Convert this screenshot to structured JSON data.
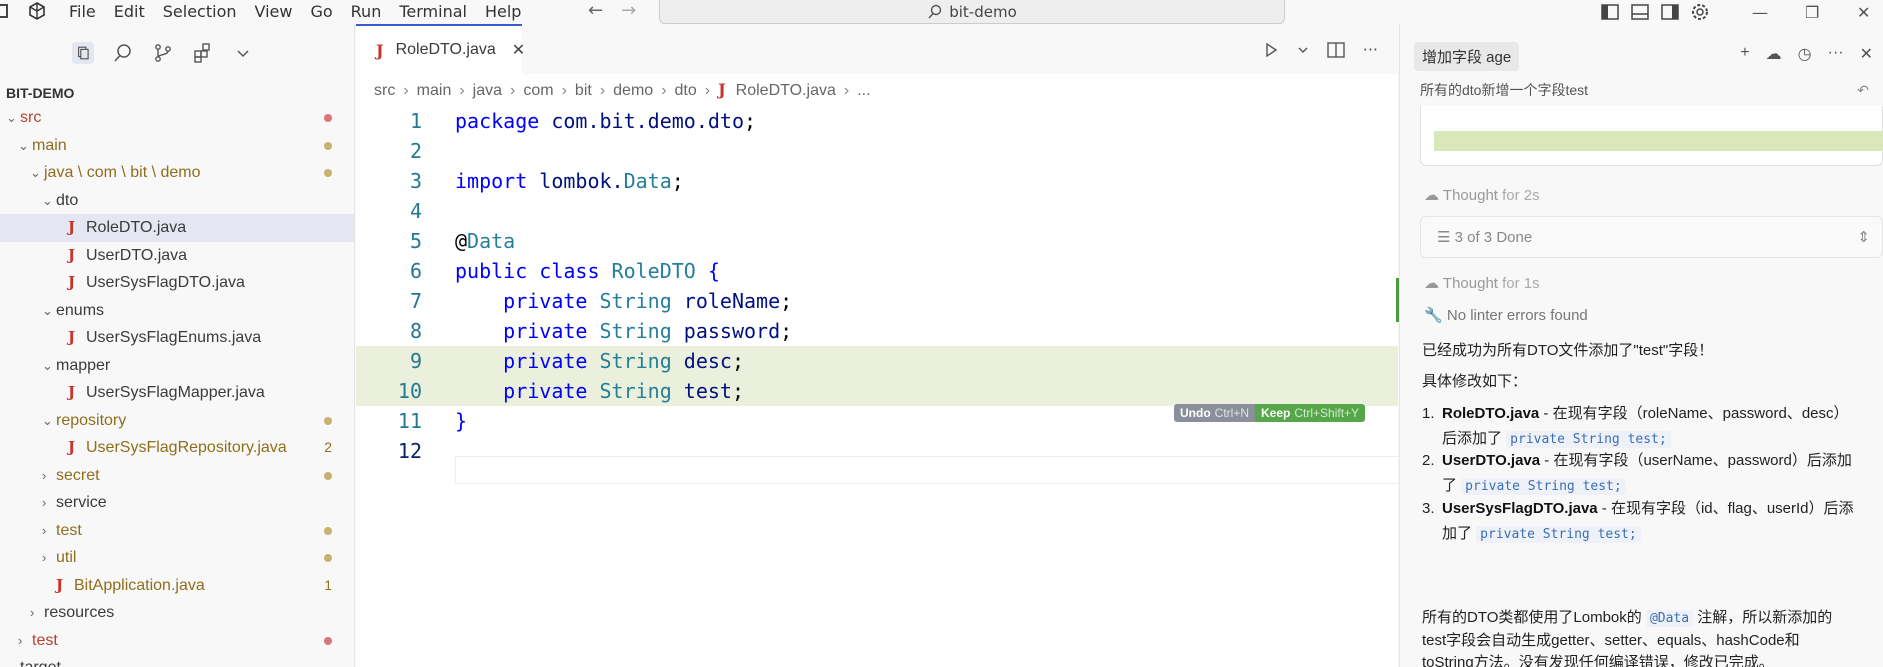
{
  "titlebar": {
    "menu": [
      "File",
      "Edit",
      "Selection",
      "View",
      "Go",
      "Run",
      "Terminal",
      "Help"
    ],
    "search_text": "bit-demo"
  },
  "explorer": {
    "root": "BIT-DEMO",
    "items": [
      {
        "label": "src",
        "indent": 0,
        "chev": "⌄",
        "kind": "folder",
        "state": "err",
        "marker": "dot-red"
      },
      {
        "label": "main",
        "indent": 1,
        "chev": "⌄",
        "kind": "folder",
        "state": "mod",
        "marker": "dot-tan"
      },
      {
        "label": "java \\ com \\ bit \\ demo",
        "indent": 2,
        "chev": "⌄",
        "kind": "folder",
        "state": "mod",
        "marker": "dot-tan"
      },
      {
        "label": "dto",
        "indent": 3,
        "chev": "⌄",
        "kind": "folder",
        "state": "",
        "marker": ""
      },
      {
        "label": "RoleDTO.java",
        "indent": 4,
        "chev": "",
        "kind": "java",
        "state": "sel",
        "marker": ""
      },
      {
        "label": "UserDTO.java",
        "indent": 4,
        "chev": "",
        "kind": "java",
        "state": "",
        "marker": ""
      },
      {
        "label": "UserSysFlagDTO.java",
        "indent": 4,
        "chev": "",
        "kind": "java",
        "state": "",
        "marker": ""
      },
      {
        "label": "enums",
        "indent": 3,
        "chev": "⌄",
        "kind": "folder",
        "state": "",
        "marker": ""
      },
      {
        "label": "UserSysFlagEnums.java",
        "indent": 4,
        "chev": "",
        "kind": "java",
        "state": "",
        "marker": ""
      },
      {
        "label": "mapper",
        "indent": 3,
        "chev": "⌄",
        "kind": "folder",
        "state": "",
        "marker": ""
      },
      {
        "label": "UserSysFlagMapper.java",
        "indent": 4,
        "chev": "",
        "kind": "java",
        "state": "",
        "marker": ""
      },
      {
        "label": "repository",
        "indent": 3,
        "chev": "⌄",
        "kind": "folder",
        "state": "mod",
        "marker": "dot-tan"
      },
      {
        "label": "UserSysFlagRepository.java",
        "indent": 4,
        "chev": "",
        "kind": "java",
        "state": "mod",
        "marker": "2"
      },
      {
        "label": "secret",
        "indent": 3,
        "chev": "›",
        "kind": "folder",
        "state": "mod",
        "marker": "dot-tan"
      },
      {
        "label": "service",
        "indent": 3,
        "chev": "›",
        "kind": "folder",
        "state": "",
        "marker": ""
      },
      {
        "label": "test",
        "indent": 3,
        "chev": "›",
        "kind": "folder",
        "state": "mod",
        "marker": "dot-tan"
      },
      {
        "label": "util",
        "indent": 3,
        "chev": "›",
        "kind": "folder",
        "state": "mod",
        "marker": "dot-tan"
      },
      {
        "label": "BitApplication.java",
        "indent": 3,
        "chev": "",
        "kind": "java",
        "state": "mod",
        "marker": "1"
      },
      {
        "label": "resources",
        "indent": 2,
        "chev": "›",
        "kind": "folder",
        "state": "",
        "marker": ""
      },
      {
        "label": "test",
        "indent": 1,
        "chev": "›",
        "kind": "folder",
        "state": "err",
        "marker": "dot-red"
      },
      {
        "label": "target",
        "indent": 0,
        "chev": "",
        "kind": "folder",
        "state": "",
        "marker": ""
      }
    ]
  },
  "editor": {
    "tab_label": "RoleDTO.java",
    "breadcrumb": [
      "src",
      "main",
      "java",
      "com",
      "bit",
      "demo",
      "dto"
    ],
    "breadcrumb_file": "RoleDTO.java",
    "breadcrumb_tail": "...",
    "lines": [
      {
        "n": "1",
        "tokens": [
          [
            "kw",
            "package "
          ],
          [
            "id",
            "com.bit.demo.dto"
          ],
          [
            "pl",
            ";"
          ]
        ],
        "added": false
      },
      {
        "n": "2",
        "tokens": [],
        "added": false
      },
      {
        "n": "3",
        "tokens": [
          [
            "kw",
            "import "
          ],
          [
            "id",
            "lombok."
          ],
          [
            "ty",
            "Data"
          ],
          [
            "pl",
            ";"
          ]
        ],
        "added": false
      },
      {
        "n": "4",
        "tokens": [],
        "added": false
      },
      {
        "n": "5",
        "tokens": [
          [
            "pl",
            "@"
          ],
          [
            "an",
            "Data"
          ]
        ],
        "added": false
      },
      {
        "n": "6",
        "tokens": [
          [
            "kw",
            "public class "
          ],
          [
            "ty",
            "RoleDTO"
          ],
          [
            "kw",
            " {"
          ]
        ],
        "added": false
      },
      {
        "n": "7",
        "tokens": [
          [
            "pl",
            "    "
          ],
          [
            "kw",
            "private "
          ],
          [
            "ty",
            "String "
          ],
          [
            "id",
            "roleName"
          ],
          [
            "pl",
            ";"
          ]
        ],
        "added": false
      },
      {
        "n": "8",
        "tokens": [
          [
            "pl",
            "    "
          ],
          [
            "kw",
            "private "
          ],
          [
            "ty",
            "String "
          ],
          [
            "id",
            "password"
          ],
          [
            "pl",
            ";"
          ]
        ],
        "added": false
      },
      {
        "n": "9",
        "tokens": [
          [
            "pl",
            "    "
          ],
          [
            "kw",
            "private "
          ],
          [
            "ty",
            "String "
          ],
          [
            "id",
            "desc"
          ],
          [
            "pl",
            ";"
          ]
        ],
        "added": true
      },
      {
        "n": "10",
        "tokens": [
          [
            "pl",
            "    "
          ],
          [
            "kw",
            "private "
          ],
          [
            "ty",
            "String "
          ],
          [
            "id",
            "test"
          ],
          [
            "pl",
            ";"
          ]
        ],
        "added": true
      },
      {
        "n": "11",
        "tokens": [
          [
            "kw",
            "}"
          ]
        ],
        "added": false
      },
      {
        "n": "12",
        "tokens": [],
        "added": false
      }
    ],
    "undo_label": "Undo",
    "undo_shortcut": "Ctrl+N",
    "keep_label": "Keep",
    "keep_shortcut": "Ctrl+Shift+Y"
  },
  "chat": {
    "tab_title": "增加字段 age",
    "prompt": "所有的dto新增一个字段test",
    "thought1": "Thought",
    "thought1_dur": "for 2s",
    "steps": "3 of 3 Done",
    "thought2": "Thought",
    "thought2_dur": "for 1s",
    "lint": "No linter errors found",
    "summary1": "已经成功为所有DTO文件添加了\"test\"字段！",
    "summary2": "具体修改如下：",
    "items": [
      {
        "num": "1.",
        "file": "RoleDTO.java",
        "text": " - 在现有字段（roleName、password、desc）",
        "text2": "后添加了 ",
        "code": "private String test;"
      },
      {
        "num": "2.",
        "file": "UserDTO.java",
        "text": " - 在现有字段（userName、password）后添加",
        "text2": "了 ",
        "code": "private String test;"
      },
      {
        "num": "3.",
        "file": "UserSysFlagDTO.java",
        "text": " - 在现有字段（id、flag、userId）后添",
        "text2": "加了 ",
        "code": "private String test;"
      }
    ],
    "footer_a": "所有的DTO类都使用了Lombok的 ",
    "footer_code": "@Data",
    "footer_b": " 注解，所以新添加的",
    "footer_c": "test字段会自动生成getter、setter、equals、hashCode和",
    "footer_d": "toString方法。没有发现任何编译错误，修改已完成。"
  }
}
